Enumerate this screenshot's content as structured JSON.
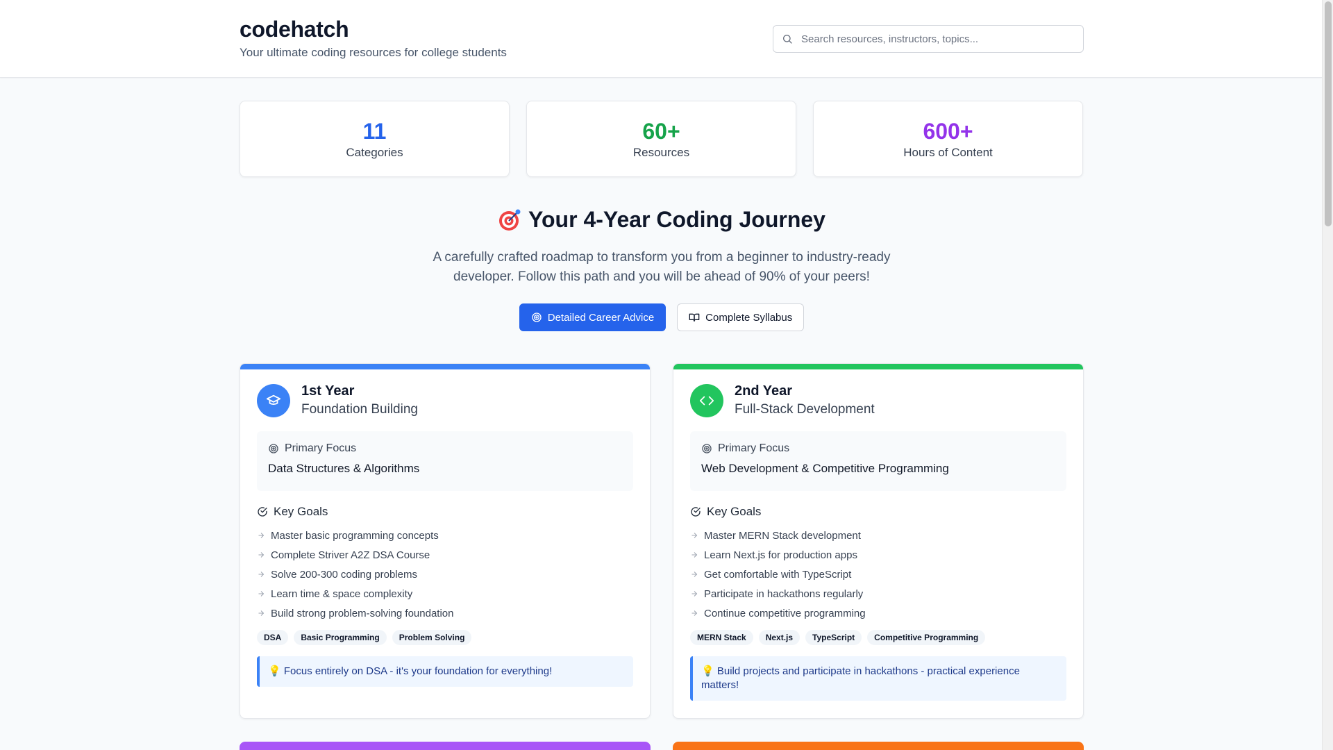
{
  "header": {
    "brand": "codehatch",
    "tagline": "Your ultimate coding resources for college students",
    "search_placeholder": "Search resources, instructors, topics..."
  },
  "stats": [
    {
      "value": "11",
      "label": "Categories",
      "color": "#2563eb"
    },
    {
      "value": "60+",
      "label": "Resources",
      "color": "#16a34a"
    },
    {
      "value": "600+",
      "label": "Hours of Content",
      "color": "#9333ea"
    }
  ],
  "journey": {
    "title": "Your 4-Year Coding Journey",
    "description": "A carefully crafted roadmap to transform you from a beginner to industry-ready developer. Follow this path and you will be ahead of 90% of your peers!",
    "primary_button": "Detailed Career Advice",
    "secondary_button": "Complete Syllabus"
  },
  "years": [
    {
      "name": "1st Year",
      "theme": "Foundation Building",
      "accent": "#3b82f6",
      "focus_label": "Primary Focus",
      "focus": "Data Structures & Algorithms",
      "goals_label": "Key Goals",
      "goals": [
        "Master basic programming concepts",
        "Complete Striver A2Z DSA Course",
        "Solve 200-300 coding problems",
        "Learn time & space complexity",
        "Build strong problem-solving foundation"
      ],
      "tags": [
        "DSA",
        "Basic Programming",
        "Problem Solving"
      ],
      "tip": "💡 Focus entirely on DSA - it's your foundation for everything!"
    },
    {
      "name": "2nd Year",
      "theme": "Full-Stack Development",
      "accent": "#22c55e",
      "focus_label": "Primary Focus",
      "focus": "Web Development & Competitive Programming",
      "goals_label": "Key Goals",
      "goals": [
        "Master MERN Stack development",
        "Learn Next.js for production apps",
        "Get comfortable with TypeScript",
        "Participate in hackathons regularly",
        "Continue competitive programming"
      ],
      "tags": [
        "MERN Stack",
        "Next.js",
        "TypeScript",
        "Competitive Programming"
      ],
      "tip": "💡 Build projects and participate in hackathons - practical experience matters!"
    }
  ],
  "next_year_accents": [
    "#a855f7",
    "#f97316"
  ]
}
